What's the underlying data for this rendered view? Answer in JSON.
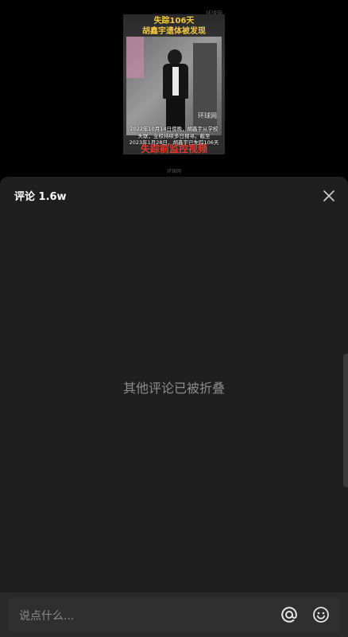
{
  "video": {
    "top_watermark": "环球网",
    "headline_line1": "失踪106天",
    "headline_line2": "胡鑫宇遗体被发现",
    "inner_watermark": "环球网",
    "caption_line1": "2022年10月14日傍晚，胡鑫宇从学校",
    "caption_line2": "失联，全校持续多日搜寻。截至",
    "caption_line3": "2023年1月28日，胡鑫宇已失踪106天",
    "red_title": "失踪前监控视频",
    "bottom_watermark": "环球网"
  },
  "comments": {
    "title": "评论 1.6w",
    "folded_notice": "其他评论已被折叠"
  },
  "input": {
    "placeholder": "说点什么..."
  },
  "icons": {
    "close": "close-icon",
    "mention": "at-icon",
    "emoji": "smile-icon"
  },
  "colors": {
    "sheet_bg": "#1f1f1f",
    "headline": "#f7c93c",
    "red_title": "#e5392f"
  }
}
